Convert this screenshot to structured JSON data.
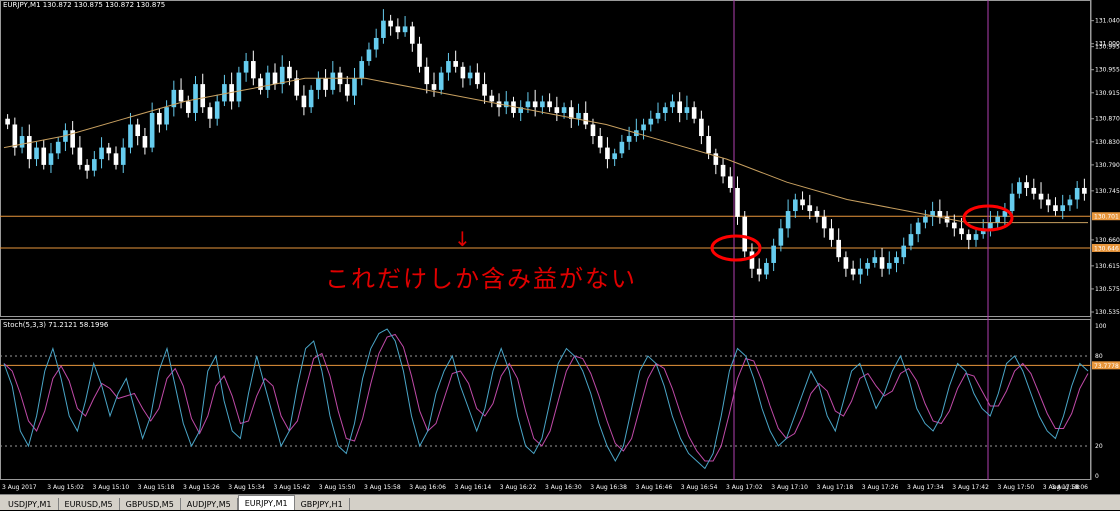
{
  "window": {
    "title": "EURJPY,M1  130.872 130.875 130.872 130.875",
    "stoch_title": "Stoch(5,3,3) 71.2121 58.1996"
  },
  "annotation": {
    "arrow": "↓",
    "text": "これだけしか含み益がない"
  },
  "colors": {
    "background": "#000000",
    "bull_candle": "#66ccee",
    "bear_candle": "#ffffff",
    "ma_line": "#c8a060",
    "hline": "#e8963c",
    "vline": "#b040b0",
    "stoch_main": "#4aa6c8",
    "stoch_signal": "#c04aa8",
    "highlight_circle": "#ff0000",
    "note_text": "#e00000"
  },
  "chart_data": [
    {
      "type": "candlestick",
      "symbol": "EURJPY",
      "timeframe": "M1",
      "ylim": [
        130.535,
        131.055
      ],
      "price_labels": [
        "131.040",
        "131.000",
        "130.995",
        "130.955",
        "130.915",
        "130.870",
        "130.830",
        "130.790",
        "130.745",
        "130.701",
        "130.660",
        "130.646",
        "130.615",
        "130.575",
        "130.535"
      ],
      "horizontal_lines": [
        {
          "value": 130.701,
          "label": "130.701"
        },
        {
          "value": 130.646,
          "label": "130.646"
        }
      ],
      "vertical_lines_at": [
        "3 Aug 16:54",
        "3 Aug 17:46"
      ],
      "x_labels": [
        "3 Aug 2017",
        "3 Aug 15:02",
        "3 Aug 15:10",
        "3 Aug 15:18",
        "3 Aug 15:26",
        "3 Aug 15:34",
        "3 Aug 15:42",
        "3 Aug 15:50",
        "3 Aug 15:58",
        "3 Aug 16:06",
        "3 Aug 16:14",
        "3 Aug 16:22",
        "3 Aug 16:30",
        "3 Aug 16:38",
        "3 Aug 16:46",
        "3 Aug 16:54",
        "3 Aug 17:02",
        "3 Aug 17:10",
        "3 Aug 17:18",
        "3 Aug 17:26",
        "3 Aug 17:34",
        "3 Aug 17:42",
        "3 Aug 17:50",
        "3 Aug 17:58",
        "3 Aug 18:06"
      ],
      "close": [
        130.86,
        130.82,
        130.84,
        130.8,
        130.82,
        130.79,
        130.81,
        130.83,
        130.85,
        130.82,
        130.79,
        130.78,
        130.8,
        130.82,
        130.81,
        130.79,
        130.82,
        130.86,
        130.84,
        130.82,
        130.88,
        130.86,
        130.89,
        130.92,
        130.9,
        130.88,
        130.93,
        130.89,
        130.87,
        130.9,
        130.93,
        130.9,
        130.95,
        130.97,
        130.94,
        130.92,
        130.95,
        130.93,
        130.96,
        130.94,
        130.91,
        130.89,
        130.92,
        130.94,
        130.92,
        130.95,
        130.93,
        130.91,
        130.94,
        130.97,
        130.99,
        131.01,
        131.04,
        131.03,
        131.02,
        131.03,
        131.0,
        130.96,
        130.93,
        130.92,
        130.95,
        130.97,
        130.96,
        130.94,
        130.95,
        130.93,
        130.91,
        130.9,
        130.89,
        130.9,
        130.88,
        130.89,
        130.9,
        130.89,
        130.9,
        130.89,
        130.88,
        130.89,
        130.87,
        130.88,
        130.86,
        130.84,
        130.82,
        130.8,
        130.81,
        130.83,
        130.84,
        130.85,
        130.86,
        130.87,
        130.88,
        130.89,
        130.9,
        130.88,
        130.89,
        130.87,
        130.84,
        130.81,
        130.79,
        130.77,
        130.75,
        130.7,
        130.64,
        130.61,
        130.6,
        130.62,
        130.65,
        130.68,
        130.71,
        130.73,
        130.72,
        130.71,
        130.7,
        130.68,
        130.66,
        130.63,
        130.61,
        130.6,
        130.61,
        130.62,
        130.63,
        130.61,
        130.62,
        130.63,
        130.65,
        130.67,
        130.69,
        130.7,
        130.71,
        130.7,
        130.69,
        130.68,
        130.67,
        130.66,
        130.67,
        130.68,
        130.69,
        130.7,
        130.71,
        130.74,
        130.76,
        130.75,
        130.74,
        130.73,
        130.72,
        130.71,
        130.72,
        130.73,
        130.75,
        130.74
      ],
      "ma_period_note": "",
      "ma": [
        130.82,
        130.84,
        130.87,
        130.9,
        130.92,
        130.94,
        130.94,
        130.92,
        130.9,
        130.88,
        130.86,
        130.83,
        130.8,
        130.76,
        130.73,
        130.71,
        130.69,
        130.69,
        130.69
      ]
    },
    {
      "type": "line",
      "name": "Stoch(5,3,3)",
      "ylim": [
        0,
        100
      ],
      "levels": [
        80,
        20
      ],
      "level_labels": [
        "100",
        "80",
        "20",
        "0"
      ],
      "current_label": "73.7778",
      "main": [
        75,
        60,
        30,
        20,
        40,
        70,
        85,
        65,
        40,
        30,
        50,
        75,
        60,
        40,
        55,
        65,
        45,
        25,
        40,
        70,
        85,
        60,
        35,
        20,
        30,
        70,
        80,
        50,
        30,
        25,
        55,
        80,
        60,
        40,
        20,
        30,
        60,
        85,
        90,
        70,
        40,
        20,
        15,
        35,
        65,
        85,
        95,
        98,
        90,
        70,
        40,
        20,
        30,
        55,
        70,
        80,
        60,
        45,
        30,
        45,
        70,
        85,
        70,
        40,
        20,
        15,
        25,
        50,
        75,
        85,
        80,
        70,
        55,
        35,
        20,
        10,
        20,
        45,
        70,
        80,
        75,
        60,
        40,
        25,
        15,
        10,
        5,
        15,
        40,
        70,
        85,
        80,
        65,
        45,
        30,
        20,
        25,
        40,
        55,
        70,
        60,
        40,
        30,
        50,
        70,
        75,
        60,
        45,
        55,
        70,
        80,
        65,
        45,
        35,
        30,
        40,
        60,
        75,
        70,
        55,
        45,
        40,
        55,
        75,
        80,
        70,
        55,
        40,
        30,
        25,
        40,
        60,
        75,
        70
      ]
    }
  ],
  "tabs": [
    "USDJPY,M1",
    "EURUSD,M5",
    "GBPUSD,M5",
    "AUDJPY,M5",
    "EURJPY,M1",
    "GBPJPY,H1"
  ],
  "active_tab": "EURJPY,M1"
}
